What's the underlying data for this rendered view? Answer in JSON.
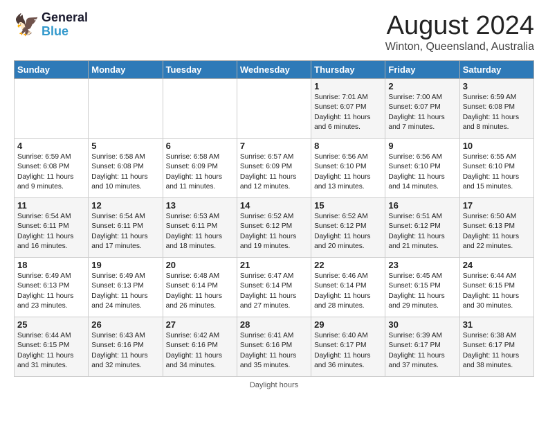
{
  "header": {
    "logo_text_general": "General",
    "logo_text_blue": "Blue",
    "month_title": "August 2024",
    "location": "Winton, Queensland, Australia"
  },
  "days_of_week": [
    "Sunday",
    "Monday",
    "Tuesday",
    "Wednesday",
    "Thursday",
    "Friday",
    "Saturday"
  ],
  "weeks": [
    [
      {
        "day": "",
        "info": ""
      },
      {
        "day": "",
        "info": ""
      },
      {
        "day": "",
        "info": ""
      },
      {
        "day": "",
        "info": ""
      },
      {
        "day": "1",
        "info": "Sunrise: 7:01 AM\nSunset: 6:07 PM\nDaylight: 11 hours and 6 minutes."
      },
      {
        "day": "2",
        "info": "Sunrise: 7:00 AM\nSunset: 6:07 PM\nDaylight: 11 hours and 7 minutes."
      },
      {
        "day": "3",
        "info": "Sunrise: 6:59 AM\nSunset: 6:08 PM\nDaylight: 11 hours and 8 minutes."
      }
    ],
    [
      {
        "day": "4",
        "info": "Sunrise: 6:59 AM\nSunset: 6:08 PM\nDaylight: 11 hours and 9 minutes."
      },
      {
        "day": "5",
        "info": "Sunrise: 6:58 AM\nSunset: 6:08 PM\nDaylight: 11 hours and 10 minutes."
      },
      {
        "day": "6",
        "info": "Sunrise: 6:58 AM\nSunset: 6:09 PM\nDaylight: 11 hours and 11 minutes."
      },
      {
        "day": "7",
        "info": "Sunrise: 6:57 AM\nSunset: 6:09 PM\nDaylight: 11 hours and 12 minutes."
      },
      {
        "day": "8",
        "info": "Sunrise: 6:56 AM\nSunset: 6:10 PM\nDaylight: 11 hours and 13 minutes."
      },
      {
        "day": "9",
        "info": "Sunrise: 6:56 AM\nSunset: 6:10 PM\nDaylight: 11 hours and 14 minutes."
      },
      {
        "day": "10",
        "info": "Sunrise: 6:55 AM\nSunset: 6:10 PM\nDaylight: 11 hours and 15 minutes."
      }
    ],
    [
      {
        "day": "11",
        "info": "Sunrise: 6:54 AM\nSunset: 6:11 PM\nDaylight: 11 hours and 16 minutes."
      },
      {
        "day": "12",
        "info": "Sunrise: 6:54 AM\nSunset: 6:11 PM\nDaylight: 11 hours and 17 minutes."
      },
      {
        "day": "13",
        "info": "Sunrise: 6:53 AM\nSunset: 6:11 PM\nDaylight: 11 hours and 18 minutes."
      },
      {
        "day": "14",
        "info": "Sunrise: 6:52 AM\nSunset: 6:12 PM\nDaylight: 11 hours and 19 minutes."
      },
      {
        "day": "15",
        "info": "Sunrise: 6:52 AM\nSunset: 6:12 PM\nDaylight: 11 hours and 20 minutes."
      },
      {
        "day": "16",
        "info": "Sunrise: 6:51 AM\nSunset: 6:12 PM\nDaylight: 11 hours and 21 minutes."
      },
      {
        "day": "17",
        "info": "Sunrise: 6:50 AM\nSunset: 6:13 PM\nDaylight: 11 hours and 22 minutes."
      }
    ],
    [
      {
        "day": "18",
        "info": "Sunrise: 6:49 AM\nSunset: 6:13 PM\nDaylight: 11 hours and 23 minutes."
      },
      {
        "day": "19",
        "info": "Sunrise: 6:49 AM\nSunset: 6:13 PM\nDaylight: 11 hours and 24 minutes."
      },
      {
        "day": "20",
        "info": "Sunrise: 6:48 AM\nSunset: 6:14 PM\nDaylight: 11 hours and 26 minutes."
      },
      {
        "day": "21",
        "info": "Sunrise: 6:47 AM\nSunset: 6:14 PM\nDaylight: 11 hours and 27 minutes."
      },
      {
        "day": "22",
        "info": "Sunrise: 6:46 AM\nSunset: 6:14 PM\nDaylight: 11 hours and 28 minutes."
      },
      {
        "day": "23",
        "info": "Sunrise: 6:45 AM\nSunset: 6:15 PM\nDaylight: 11 hours and 29 minutes."
      },
      {
        "day": "24",
        "info": "Sunrise: 6:44 AM\nSunset: 6:15 PM\nDaylight: 11 hours and 30 minutes."
      }
    ],
    [
      {
        "day": "25",
        "info": "Sunrise: 6:44 AM\nSunset: 6:15 PM\nDaylight: 11 hours and 31 minutes."
      },
      {
        "day": "26",
        "info": "Sunrise: 6:43 AM\nSunset: 6:16 PM\nDaylight: 11 hours and 32 minutes."
      },
      {
        "day": "27",
        "info": "Sunrise: 6:42 AM\nSunset: 6:16 PM\nDaylight: 11 hours and 34 minutes."
      },
      {
        "day": "28",
        "info": "Sunrise: 6:41 AM\nSunset: 6:16 PM\nDaylight: 11 hours and 35 minutes."
      },
      {
        "day": "29",
        "info": "Sunrise: 6:40 AM\nSunset: 6:17 PM\nDaylight: 11 hours and 36 minutes."
      },
      {
        "day": "30",
        "info": "Sunrise: 6:39 AM\nSunset: 6:17 PM\nDaylight: 11 hours and 37 minutes."
      },
      {
        "day": "31",
        "info": "Sunrise: 6:38 AM\nSunset: 6:17 PM\nDaylight: 11 hours and 38 minutes."
      }
    ]
  ],
  "footer": {
    "daylight_hours_label": "Daylight hours"
  }
}
